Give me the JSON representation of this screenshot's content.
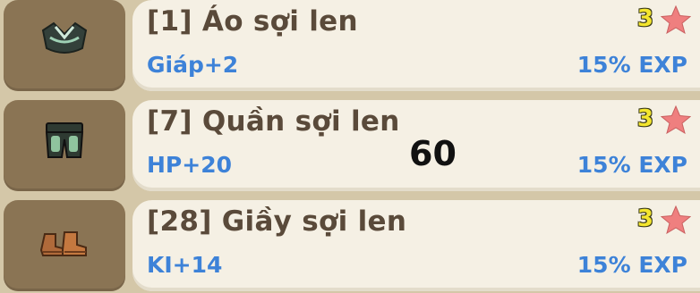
{
  "items": [
    {
      "name": "[1] Áo sợi len",
      "stat": "Giáp+2",
      "exp": "15% EXP",
      "star_count": "3",
      "icon": "shirt-icon"
    },
    {
      "name": "[7] Quần sợi len",
      "stat": "HP+20",
      "exp": "15% EXP",
      "star_count": "3",
      "icon": "pants-icon"
    },
    {
      "name": "[28] Giầy sợi len",
      "stat": "KI+14",
      "exp": "15% EXP",
      "star_count": "3",
      "icon": "boots-icon"
    }
  ],
  "overlay_number": "60",
  "colors": {
    "stat_text": "#3d82d8",
    "name_text": "#5a4a3a",
    "star": "#ef7f7f",
    "star_count": "#f3e52e",
    "icon_box": "#8a7454",
    "panel": "#f5f0e4"
  }
}
